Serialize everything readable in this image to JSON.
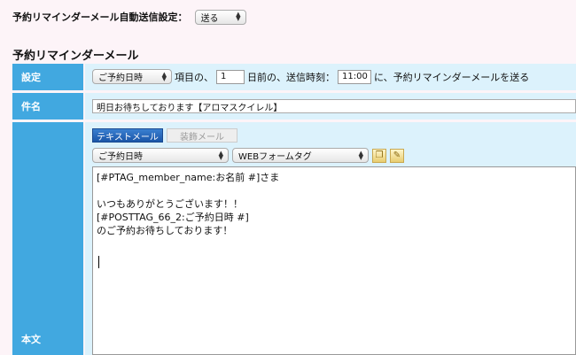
{
  "auto_send": {
    "label": "予約リマインダーメール自動送信設定：",
    "value": "送る"
  },
  "section_title": "予約リマインダーメール",
  "settings_row": {
    "label": "設定",
    "item_select": "ご予約日時",
    "text_item_of": "項目の、",
    "days": "1",
    "text_days_before": "日前の、送信時刻：",
    "time": "11:00",
    "text_suffix": "に、予約リマインダーメールを送る"
  },
  "subject_row": {
    "label": "件名",
    "value": "明日お待ちしております【アロマスクイレル】"
  },
  "body_row": {
    "label": "本文",
    "tabs": [
      "テキストメール",
      "装飾メール"
    ],
    "insert_select": "ご予約日時",
    "tag_select": "WEBフォームタグ",
    "icons": [
      "paste-icon",
      "edit-icon"
    ],
    "lines": [
      "[#PTAG_member_name:お名前 #]さま",
      "",
      "いつもありがとうございます！！",
      "[#POSTTAG_66_2:ご予約日時 #]",
      "のご予約お待ちしております！"
    ]
  },
  "colors": {
    "label_bg": "#41a8e0",
    "cell_bg": "#dcf2fc",
    "page_bg": "#fdf4f8"
  }
}
